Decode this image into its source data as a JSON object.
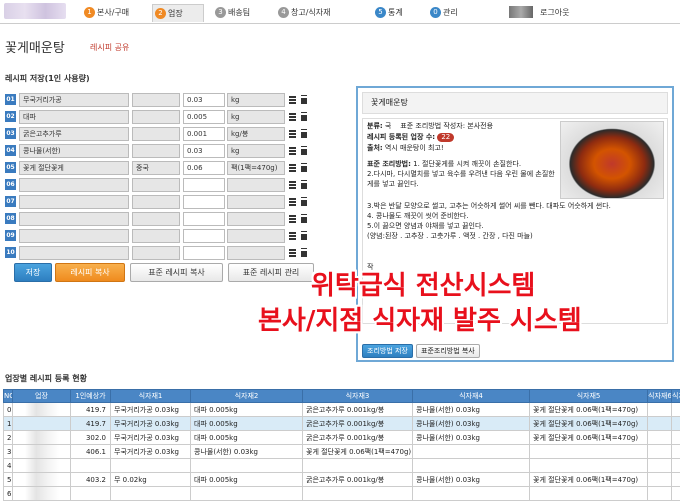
{
  "nav": {
    "tabs": [
      {
        "num": "1",
        "label": "본사/구매"
      },
      {
        "num": "2",
        "label": "업장"
      },
      {
        "num": "3",
        "label": "배송팀"
      },
      {
        "num": "4",
        "label": "창고/식자재"
      },
      {
        "num": "5",
        "label": "통계"
      },
      {
        "num": "0",
        "label": "관리"
      }
    ],
    "logout": "로그아웃"
  },
  "page": {
    "title": "꽃게매운탕",
    "share": "레시피 공유"
  },
  "recipe": {
    "section_title": "레시피 저장(1인 사용량)",
    "rows": [
      {
        "no": "01",
        "name": "무국거리가공",
        "origin": "",
        "qty": "0.03",
        "unit": "kg"
      },
      {
        "no": "02",
        "name": "대파",
        "origin": "",
        "qty": "0.005",
        "unit": "kg"
      },
      {
        "no": "03",
        "name": "굵은고추가루",
        "origin": "",
        "qty": "0.001",
        "unit": "kg/봉"
      },
      {
        "no": "04",
        "name": "콩나물(서한)",
        "origin": "",
        "qty": "0.03",
        "unit": "kg"
      },
      {
        "no": "05",
        "name": "꽃게 절단꽃게",
        "origin": "중국",
        "qty": "0.06",
        "unit": "팩(1팩=470g)"
      },
      {
        "no": "06",
        "name": "",
        "origin": "",
        "qty": "",
        "unit": ""
      },
      {
        "no": "07",
        "name": "",
        "origin": "",
        "qty": "",
        "unit": ""
      },
      {
        "no": "08",
        "name": "",
        "origin": "",
        "qty": "",
        "unit": ""
      },
      {
        "no": "09",
        "name": "",
        "origin": "",
        "qty": "",
        "unit": ""
      },
      {
        "no": "10",
        "name": "",
        "origin": "",
        "qty": "",
        "unit": ""
      }
    ],
    "buttons": {
      "save": "저장",
      "copy": "레시피 복사",
      "std_copy": "표준 레시피 복사",
      "std_manage": "표준 레시피 관리"
    }
  },
  "popup": {
    "title": "꽃게매운탕",
    "category_label": "분류:",
    "category_value": "국",
    "author_label": "표준 조리방법 작성자:",
    "author_value": "본사전용",
    "count_label": "레시피 등록된 업장 수:",
    "count_value": "22",
    "source_label": "출처:",
    "source_value": "역시 매운탕이 최고!",
    "method_label": "표준 조리방법:",
    "method_lines": [
      "1. 절단꽃게를 시켜 깨끗이 손질한다.",
      "2.다시마, 다시멸치를 넣고 육수를 우려낸 다음 우린 물에 손질한 게를 넣고 끓인다.",
      "3.박은 반달 모양으로 썰고, 고추는 어슷하게 썰어 씨를 뺀다. 대파도 어슷하게 썬다.",
      "4. 콩나물도 깨끗이 씻어 준비한다.",
      "5.이 끓으면 양념과 야채를 넣고 끓인다.",
      "(양념:된장 . 고추장 . 고춧가루 . 액젓 . 간장 , 다진 마늘)"
    ],
    "note_label": "작",
    "btn_save": "조리방법 저장",
    "btn_copy": "표준조리방법 복사"
  },
  "overlay": {
    "line1": "위탁급식 전산시스템",
    "line2": "본사/지점 식자재 발주 시스템"
  },
  "table": {
    "title": "업장별 레시피 등록 현황",
    "headers": [
      "NO",
      "업장",
      "1인예상가",
      "식자재1",
      "식자재2",
      "식자재3",
      "식자재4",
      "식자재5",
      "식자재6",
      "식자"
    ],
    "rows": [
      {
        "no": "0",
        "price": "419.7",
        "c1": "무국거리가공 0.03kg",
        "c2": "대파 0.005kg",
        "c3": "굵은고추가루 0.001kg/봉",
        "c4": "콩나물(서한) 0.03kg",
        "c5": "꽃게 절단꽃게 0.06팩(1팩=470g)",
        "c6": ""
      },
      {
        "no": "1",
        "price": "419.7",
        "c1": "무국거리가공 0.03kg",
        "c2": "대파 0.005kg",
        "c3": "굵은고추가루 0.001kg/봉",
        "c4": "콩나물(서한) 0.03kg",
        "c5": "꽃게 절단꽃게 0.06팩(1팩=470g)",
        "c6": ""
      },
      {
        "no": "2",
        "price": "302.0",
        "c1": "무국거리가공 0.03kg",
        "c2": "대파 0.005kg",
        "c3": "굵은고추가루 0.001kg/봉",
        "c4": "콩나물(서한) 0.03kg",
        "c5": "꽃게 절단꽃게 0.06팩(1팩=470g)",
        "c6": ""
      },
      {
        "no": "3",
        "price": "406.1",
        "c1": "무국거리가공 0.03kg",
        "c2": "콩나물(서한) 0.03kg",
        "c3": "꽃게 절단꽃게 0.06팩(1팩=470g)",
        "c4": "",
        "c5": "",
        "c6": ""
      },
      {
        "no": "4",
        "price": "",
        "c1": "",
        "c2": "",
        "c3": "",
        "c4": "",
        "c5": "",
        "c6": ""
      },
      {
        "no": "5",
        "price": "403.2",
        "c1": "무 0.02kg",
        "c2": "대파 0.005kg",
        "c3": "굵은고추가루 0.001kg/봉",
        "c4": "콩나물(서한) 0.03kg",
        "c5": "꽃게 절단꽃게 0.06팩(1팩=470g)",
        "c6": ""
      },
      {
        "no": "6",
        "price": "",
        "c1": "",
        "c2": "",
        "c3": "",
        "c4": "",
        "c5": "",
        "c6": ""
      }
    ]
  }
}
